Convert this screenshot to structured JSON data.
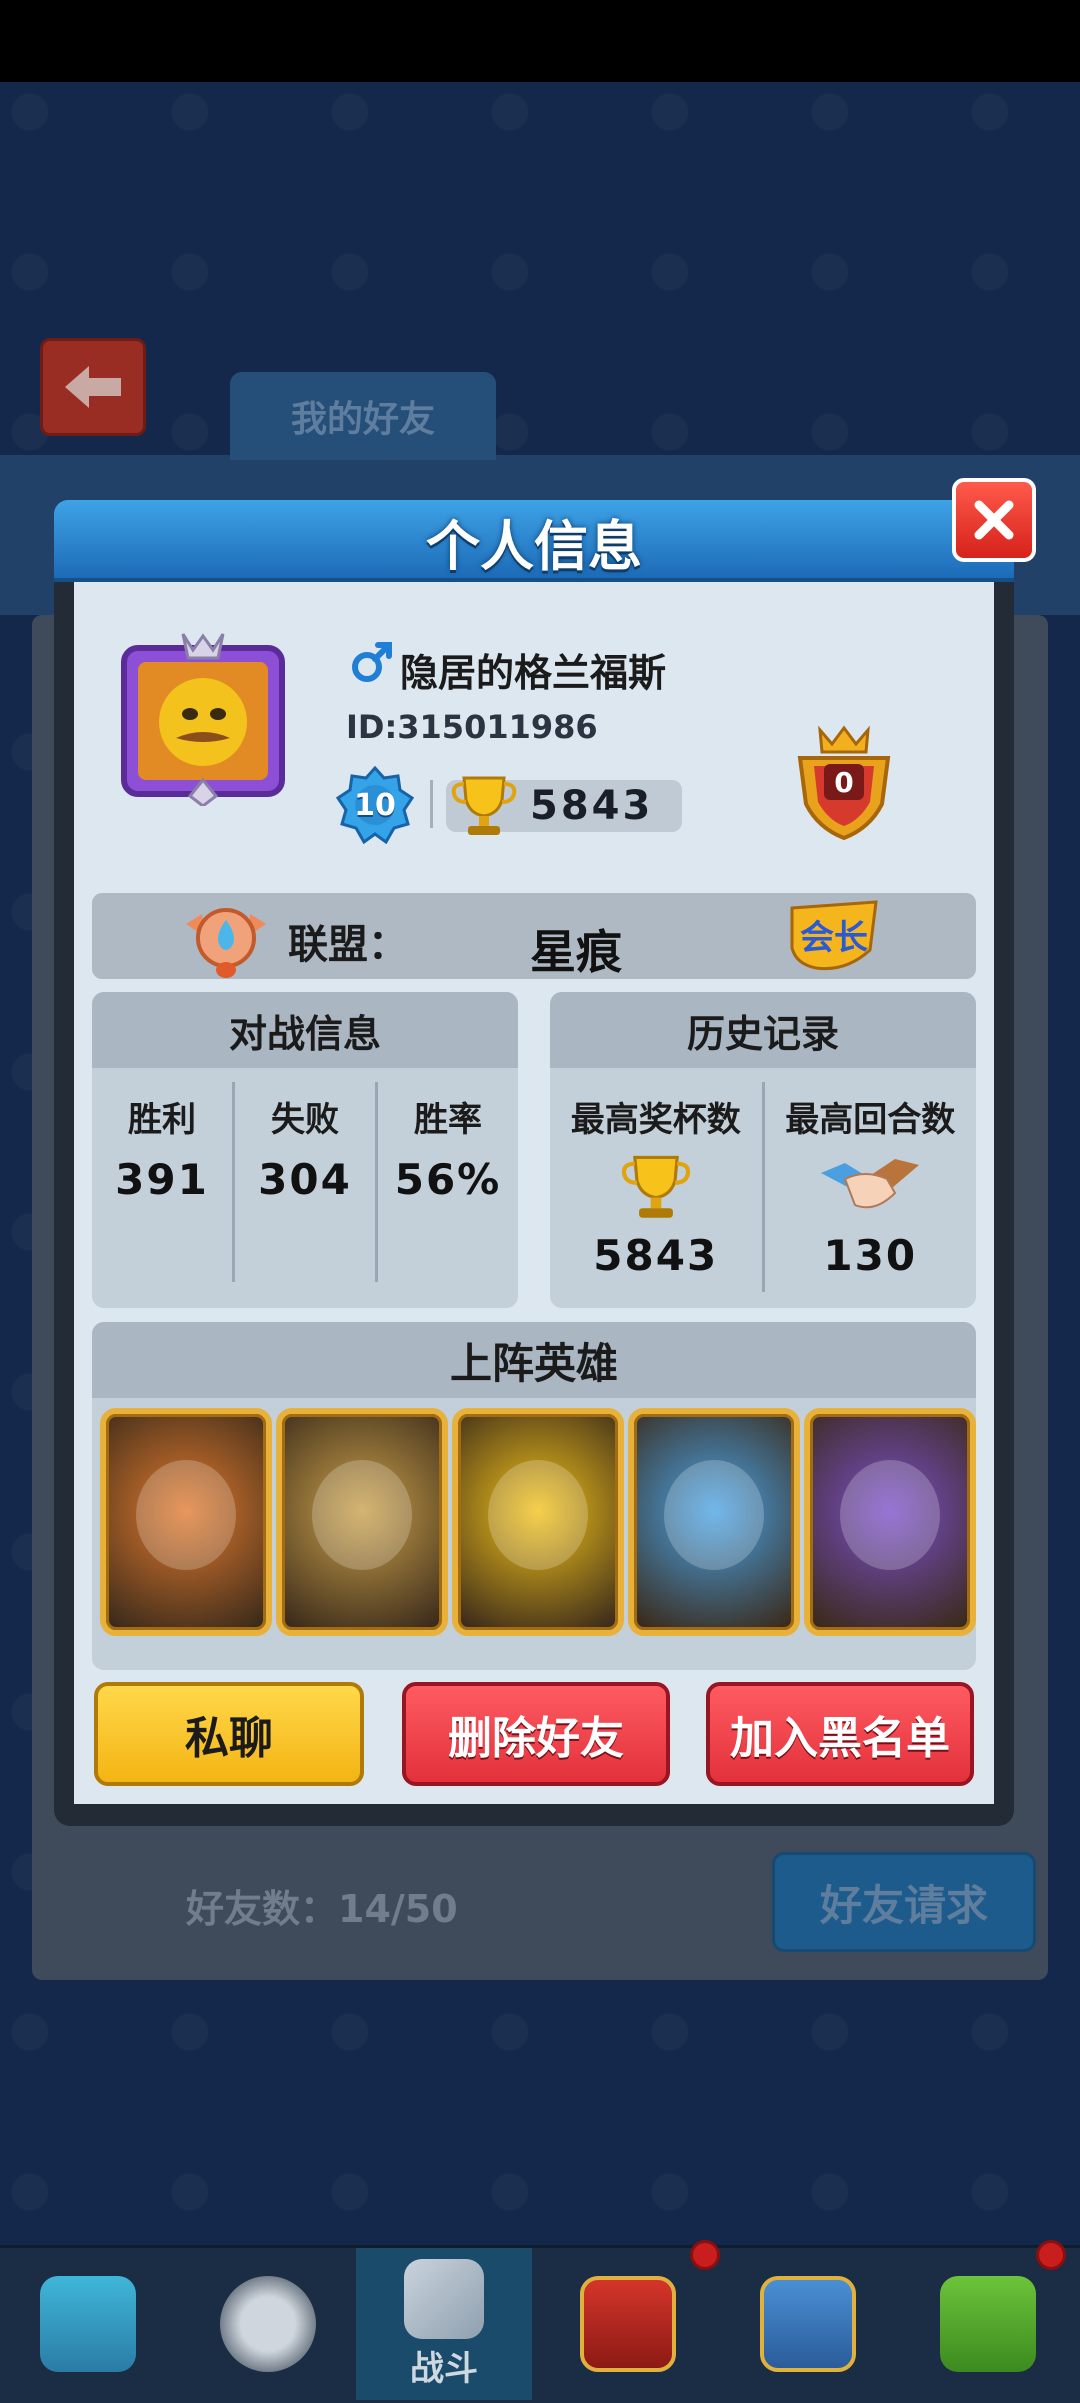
{
  "background": {
    "tab_label": "我的好友",
    "friend_count": "好友数：14/50",
    "friend_request_label": "好友请求"
  },
  "dialog": {
    "title": "个人信息",
    "player": {
      "name": "隐居的格兰福斯",
      "id_text": "ID:315011986",
      "level": "10",
      "trophies": "5843",
      "rank": "0"
    },
    "alliance": {
      "label": "联盟：",
      "name": "星痕",
      "role_badge": "会长"
    },
    "battle_info": {
      "title": "对战信息",
      "stats": [
        {
          "label": "胜利",
          "value": "391"
        },
        {
          "label": "失败",
          "value": "304"
        },
        {
          "label": "胜率",
          "value": "56%"
        }
      ]
    },
    "history": {
      "title": "历史记录",
      "stats": [
        {
          "label": "最高奖杯数",
          "value": "5843",
          "icon": "trophy-icon"
        },
        {
          "label": "最高回合数",
          "value": "130",
          "icon": "handshake-icon"
        }
      ]
    },
    "heroes": {
      "title": "上阵英雄",
      "items": [
        {
          "name": "monkey-king-hero",
          "color": "#e07a2e"
        },
        {
          "name": "wood-warrior-hero",
          "color": "#c9a04a"
        },
        {
          "name": "chef-duck-hero",
          "color": "#f2c21a"
        },
        {
          "name": "clown-hero",
          "color": "#4aa3e6"
        },
        {
          "name": "dark-mage-hero",
          "color": "#7a4fc9"
        }
      ]
    },
    "buttons": {
      "chat": "私聊",
      "delete_friend": "删除好友",
      "blacklist": "加入黑名单"
    }
  },
  "bottom_nav": {
    "battle_label": "战斗"
  }
}
